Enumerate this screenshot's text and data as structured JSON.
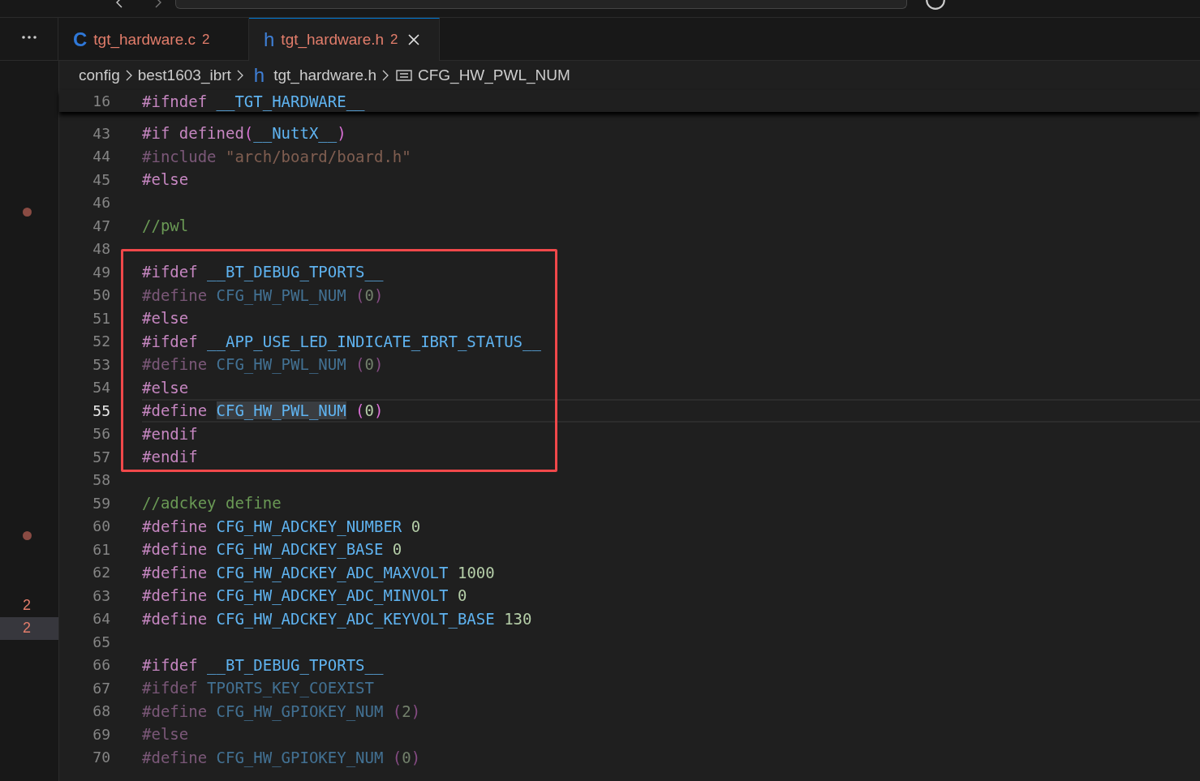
{
  "tabs": [
    {
      "icon": "C",
      "label": "tgt_hardware.c",
      "problems": "2",
      "selected": false
    },
    {
      "icon": "h",
      "label": "tgt_hardware.h",
      "problems": "2",
      "selected": true
    }
  ],
  "breadcrumbs": [
    {
      "kind": "folder",
      "label": "config"
    },
    {
      "kind": "folder",
      "label": "best1603_ibrt"
    },
    {
      "kind": "file",
      "icon": "h",
      "label": "tgt_hardware.h"
    },
    {
      "kind": "symbol",
      "label": "CFG_HW_PWL_NUM"
    }
  ],
  "sticky_line": {
    "number": "16",
    "tokens": [
      {
        "kind": "keyword",
        "text": "#ifndef "
      },
      {
        "kind": "macro",
        "text": "__TGT_HARDWARE__"
      }
    ]
  },
  "segments": [
    {
      "boxed": false,
      "lines": [
        {
          "number": "43",
          "current": false,
          "inactive": false,
          "tokens": [
            {
              "kind": "keyword",
              "text": "#if defined"
            },
            {
              "kind": "paren",
              "text": "("
            },
            {
              "kind": "macro",
              "text": "__NuttX__"
            },
            {
              "kind": "paren",
              "text": ")"
            }
          ]
        },
        {
          "number": "44",
          "current": false,
          "inactive": true,
          "tokens": [
            {
              "kind": "keyword",
              "text": "#include "
            },
            {
              "kind": "string",
              "text": "\"arch/board/board.h\""
            }
          ]
        },
        {
          "number": "45",
          "current": false,
          "inactive": false,
          "tokens": [
            {
              "kind": "keyword",
              "text": "#else"
            }
          ]
        },
        {
          "number": "46",
          "current": false,
          "side": {
            "kind": "dot"
          }
        },
        {
          "number": "47",
          "current": false,
          "inactive": false,
          "tokens": [
            {
              "kind": "comment",
              "text": "//pwl"
            }
          ]
        },
        {
          "number": "48",
          "current": false
        }
      ]
    },
    {
      "boxed": true,
      "lines": [
        {
          "number": "49",
          "current": false,
          "inactive": false,
          "tokens": [
            {
              "kind": "keyword",
              "text": "#ifdef "
            },
            {
              "kind": "macro",
              "text": "__BT_DEBUG_TPORTS__"
            }
          ]
        },
        {
          "number": "50",
          "current": false,
          "inactive": true,
          "tokens": [
            {
              "kind": "keyword",
              "text": "#define "
            },
            {
              "kind": "macro",
              "text": "CFG_HW_PWL_NUM "
            },
            {
              "kind": "paren",
              "text": "("
            },
            {
              "kind": "number",
              "text": "0"
            },
            {
              "kind": "paren",
              "text": ")"
            }
          ]
        },
        {
          "number": "51",
          "current": false,
          "inactive": false,
          "tokens": [
            {
              "kind": "keyword",
              "text": "#else"
            }
          ]
        },
        {
          "number": "52",
          "current": false,
          "inactive": false,
          "tokens": [
            {
              "kind": "keyword",
              "text": "#ifdef "
            },
            {
              "kind": "macro",
              "text": "__APP_USE_LED_INDICATE_IBRT_STATUS__"
            }
          ]
        },
        {
          "number": "53",
          "current": false,
          "inactive": true,
          "tokens": [
            {
              "kind": "keyword",
              "text": "#define "
            },
            {
              "kind": "macro",
              "text": "CFG_HW_PWL_NUM "
            },
            {
              "kind": "paren",
              "text": "("
            },
            {
              "kind": "number",
              "text": "0"
            },
            {
              "kind": "paren",
              "text": ")"
            }
          ]
        },
        {
          "number": "54",
          "current": false,
          "inactive": false,
          "tokens": [
            {
              "kind": "keyword",
              "text": "#else"
            }
          ]
        },
        {
          "number": "55",
          "current": true,
          "inactive": false,
          "tokens": [
            {
              "kind": "keyword",
              "text": "#define "
            },
            {
              "kind": "macro",
              "text": "CFG_HW_PWL_NUM",
              "highlighted": true
            },
            {
              "kind": "paren",
              "text": " ("
            },
            {
              "kind": "number",
              "text": "0"
            },
            {
              "kind": "paren",
              "text": ")"
            }
          ]
        },
        {
          "number": "56",
          "current": false,
          "inactive": false,
          "tokens": [
            {
              "kind": "keyword",
              "text": "#endif"
            }
          ]
        },
        {
          "number": "57",
          "current": false,
          "inactive": false,
          "tokens": [
            {
              "kind": "keyword",
              "text": "#endif"
            }
          ]
        }
      ]
    },
    {
      "boxed": false,
      "lines": [
        {
          "number": "58",
          "current": false
        },
        {
          "number": "59",
          "current": false,
          "inactive": false,
          "tokens": [
            {
              "kind": "comment",
              "text": "//adckey define"
            }
          ]
        },
        {
          "number": "60",
          "current": false,
          "inactive": false,
          "side": {
            "kind": "dot"
          },
          "tokens": [
            {
              "kind": "keyword",
              "text": "#define "
            },
            {
              "kind": "macro",
              "text": "CFG_HW_ADCKEY_NUMBER "
            },
            {
              "kind": "number",
              "text": "0"
            }
          ]
        },
        {
          "number": "61",
          "current": false,
          "inactive": false,
          "tokens": [
            {
              "kind": "keyword",
              "text": "#define "
            },
            {
              "kind": "macro",
              "text": "CFG_HW_ADCKEY_BASE "
            },
            {
              "kind": "number",
              "text": "0"
            }
          ]
        },
        {
          "number": "62",
          "current": false,
          "inactive": false,
          "tokens": [
            {
              "kind": "keyword",
              "text": "#define "
            },
            {
              "kind": "macro",
              "text": "CFG_HW_ADCKEY_ADC_MAXVOLT "
            },
            {
              "kind": "number",
              "text": "1000"
            }
          ]
        },
        {
          "number": "63",
          "current": false,
          "inactive": false,
          "side": {
            "kind": "count",
            "text": "2",
            "selected": false
          },
          "tokens": [
            {
              "kind": "keyword",
              "text": "#define "
            },
            {
              "kind": "macro",
              "text": "CFG_HW_ADCKEY_ADC_MINVOLT "
            },
            {
              "kind": "number",
              "text": "0"
            }
          ]
        },
        {
          "number": "64",
          "current": false,
          "inactive": false,
          "side": {
            "kind": "count",
            "text": "2",
            "selected": true
          },
          "tokens": [
            {
              "kind": "keyword",
              "text": "#define "
            },
            {
              "kind": "macro",
              "text": "CFG_HW_ADCKEY_ADC_KEYVOLT_BASE "
            },
            {
              "kind": "number",
              "text": "130"
            }
          ]
        },
        {
          "number": "65",
          "current": false
        },
        {
          "number": "66",
          "current": false,
          "inactive": false,
          "tokens": [
            {
              "kind": "keyword",
              "text": "#ifdef "
            },
            {
              "kind": "macro",
              "text": "__BT_DEBUG_TPORTS__"
            }
          ]
        },
        {
          "number": "67",
          "current": false,
          "inactive": true,
          "tokens": [
            {
              "kind": "keyword",
              "text": "#ifdef "
            },
            {
              "kind": "macro",
              "text": "TPORTS_KEY_COEXIST"
            }
          ]
        },
        {
          "number": "68",
          "current": false,
          "inactive": true,
          "tokens": [
            {
              "kind": "keyword",
              "text": "#define "
            },
            {
              "kind": "macro",
              "text": "CFG_HW_GPIOKEY_NUM "
            },
            {
              "kind": "paren",
              "text": "("
            },
            {
              "kind": "number",
              "text": "2"
            },
            {
              "kind": "paren",
              "text": ")"
            }
          ]
        },
        {
          "number": "69",
          "current": false,
          "inactive": true,
          "tokens": [
            {
              "kind": "keyword",
              "text": "#else"
            }
          ]
        },
        {
          "number": "70",
          "current": false,
          "inactive": true,
          "tokens": [
            {
              "kind": "keyword",
              "text": "#define "
            },
            {
              "kind": "macro",
              "text": "CFG_HW_GPIOKEY_NUM "
            },
            {
              "kind": "paren",
              "text": "("
            },
            {
              "kind": "number",
              "text": "0"
            },
            {
              "kind": "paren",
              "text": ")"
            }
          ]
        }
      ]
    }
  ]
}
